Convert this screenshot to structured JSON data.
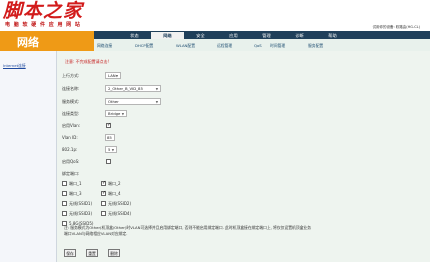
{
  "header": {
    "logo": "脚本之家",
    "logo_sub": "电 脑 软 硬 件 应 用 网 站",
    "device_info": "试用你的设备: 软路由(HG-CL)"
  },
  "tabs": [
    "状态",
    "网络",
    "安全",
    "应用",
    "管理",
    "诊断",
    "帮助"
  ],
  "active_tab": 1,
  "side_section": "网络",
  "subtabs": [
    "网络连接",
    "DHCP配置",
    "WLAN配置",
    "远程管理",
    "QoS",
    "时间管理",
    "服务配置"
  ],
  "sidebar": {
    "items": [
      "Internet连接"
    ]
  },
  "form": {
    "note": "注意: 不完成配置请点击!",
    "fields": [
      {
        "label": "上行方式:",
        "value": "LAN"
      },
      {
        "label": "连接名称:",
        "value": "2_Other_B_VID_85"
      },
      {
        "label": "服务模式:",
        "value": "Other"
      },
      {
        "label": "连接类型:",
        "value": "Bridge"
      },
      {
        "label": "启用Vlan:",
        "value": ""
      },
      {
        "label": "Vlan ID:",
        "value": "85"
      },
      {
        "label": "802.1p:",
        "value": "5"
      },
      {
        "label": "启用QoS:",
        "value": ""
      },
      {
        "label": "绑定端口:",
        "value": ""
      }
    ],
    "ports": [
      "端口_1",
      "端口_2",
      "端口_3",
      "端口_4",
      "无线(SSID1)",
      "无线(SSID2)",
      "无线(SSID3)",
      "无线(SSID4)",
      "5.8G(SSID5)"
    ],
    "description": "注: 服务模式为Other(机顶盒/Other)时VLAN可选择并且启用绑定端口, 否则不能启用绑定端口. 此时机顶盒接在绑定端口上, 将仅仅设置机顶盒业务端口VLAN与网络相应VLAN对应绑定.",
    "buttons": [
      "保存",
      "重置",
      "删除"
    ]
  }
}
